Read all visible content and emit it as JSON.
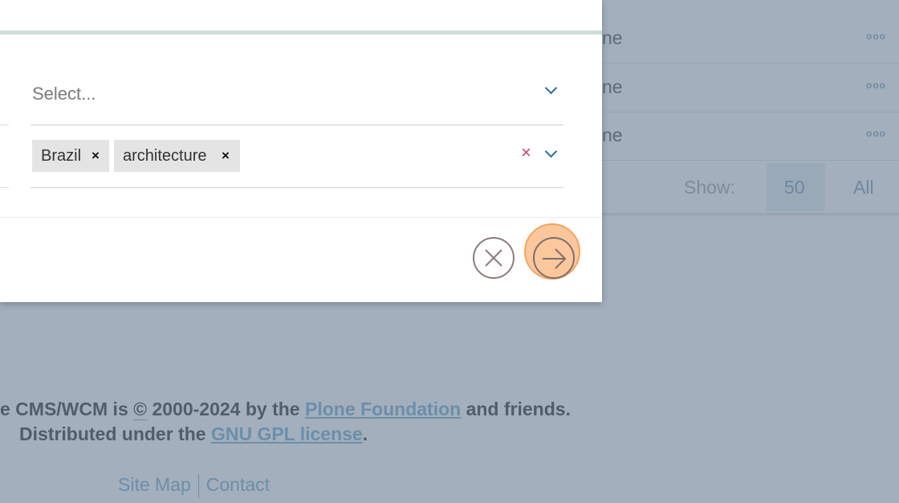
{
  "background": {
    "rows": [
      {
        "text": "ne",
        "menu_icon": "more-dots-icon"
      },
      {
        "text": "ne",
        "menu_icon": "more-dots-icon"
      },
      {
        "text": "ne",
        "menu_icon": "more-dots-icon"
      }
    ],
    "show_label": "Show:",
    "show_options": [
      "50",
      "All"
    ],
    "show_selected": "50"
  },
  "modal": {
    "select_placeholder": "Select...",
    "tags": [
      {
        "label": "Brazil",
        "remove": "×"
      },
      {
        "label": "architecture",
        "remove": "×"
      }
    ],
    "clear_icon": "×",
    "cancel_icon": "close-circle-icon",
    "submit_icon": "arrow-right-circle-icon",
    "highlight_color": "#f7a35c"
  },
  "footer": {
    "line1_prefix": "e CMS/WCM is ",
    "copyright": "©",
    "line1_mid": " 2000-2024 by the ",
    "plone_link": "Plone Foundation",
    "line1_suffix": " and friends.",
    "line2_prefix": "Distributed under the ",
    "gpl_link": "GNU GPL license",
    "line2_suffix": ".",
    "site_map": "Site Map",
    "contact": "Contact"
  }
}
